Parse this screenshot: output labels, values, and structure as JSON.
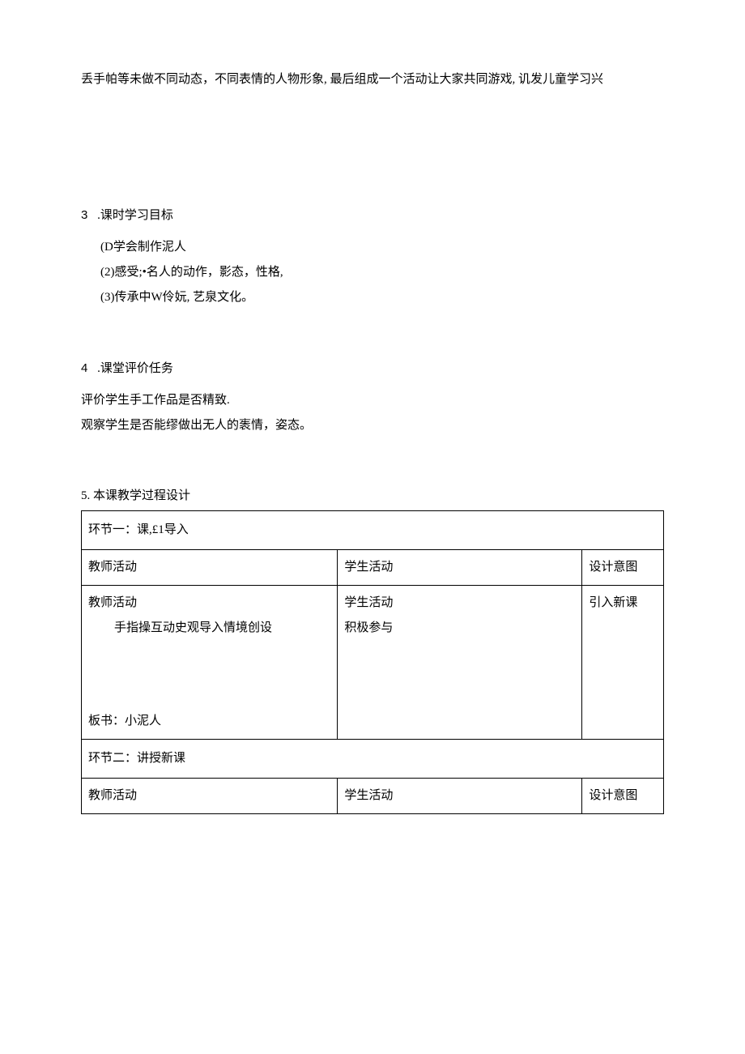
{
  "intro": "丢手帕等未做不同动态，不同表情的人物形象, 最后组成一个活动让大家共同游戏, 讥发儿童学习兴",
  "section3": {
    "heading_num": "3",
    "heading_text": ".课时学习目标",
    "item1": "(D学会制作泥人",
    "item2": "(2)感受;•名人的动作，影态，性格,",
    "item3": "(3)传承中W伶妧, 艺泉文化。"
  },
  "section4": {
    "heading_num": "4",
    "heading_text": ".课堂评价任务",
    "line1": "评价学生手工作品是否精致.",
    "line2": "观察学生是否能缪做出无人的袠情，姿态。"
  },
  "section5": {
    "title": "5. 本课教学过程设计",
    "table": {
      "row1": "环节一：课,£1导入",
      "header": {
        "col1": "教师活动",
        "col2": "学生活动",
        "col3": "设计意图"
      },
      "content_row": {
        "col1_line1": "教师活动",
        "col1_line2": "手指操互动史观导入情境创设",
        "col1_bottom": "板书：小泥人",
        "col2_line1": "学生活动",
        "col2_line2": "积极参与",
        "col3": "引入新课"
      },
      "row4": "环节二：讲授新课",
      "header2": {
        "col1": "教师活动",
        "col2": "学生活动",
        "col3": "设计意图"
      }
    }
  }
}
